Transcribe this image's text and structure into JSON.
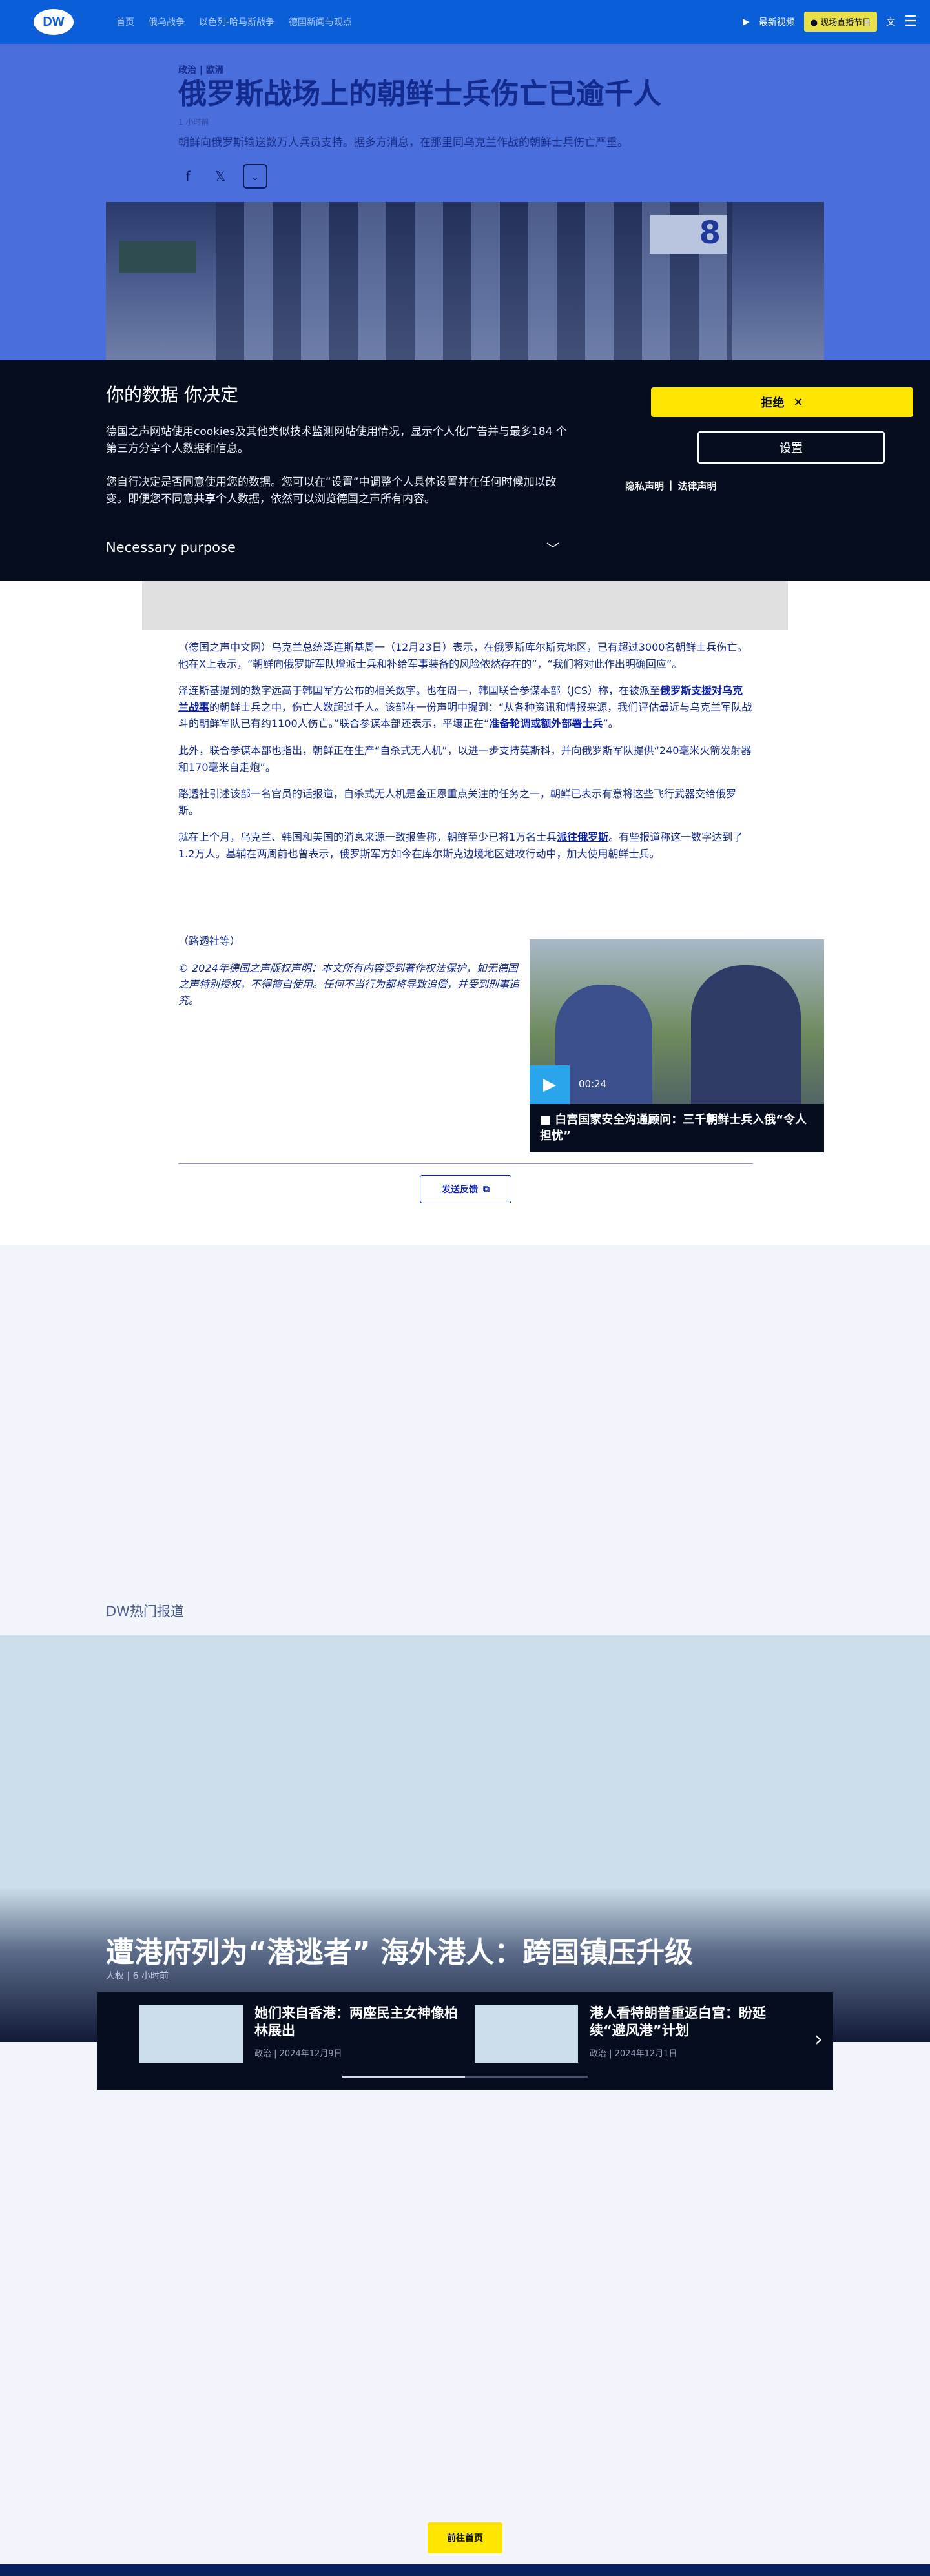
{
  "header": {
    "logo": "DW",
    "nav": [
      "首页",
      "俄乌战争",
      "以色列-哈马斯战争",
      "德国新闻与观点"
    ],
    "live_tv": "现场直播节目",
    "latest_video": "最新视频"
  },
  "article": {
    "kicker": "政治 | 欧洲",
    "title": "俄罗斯战场上的朝鲜士兵伤亡已逾千人",
    "time_ago": "1 小时前",
    "teaser": "朝鲜向俄罗斯输送数万人兵员支持。据多方消息，在那里同乌克兰作战的朝鲜士兵伤亡严重。",
    "hero_sign": "8",
    "paragraphs": [
      {
        "pre": "（德国之声中文网）乌克兰总统泽连斯基周一（12月23日）表示，在俄罗斯库尔斯克地区，已有超过3000名朝鲜士兵伤亡。他在X上表示，“朝鲜向俄罗斯军队增派士兵和补给军事装备的风险依然存在的”，“我们将对此作出明确回应”。",
        "link": "",
        "post": ""
      },
      {
        "pre": "泽连斯基提到的数字远高于韩国军方公布的相关数字。也在周一，韩国联合参谋本部（JCS）称，在被派至",
        "link": "俄罗斯支援对乌克兰战事",
        "post": "的朝鲜士兵之中，伤亡人数超过千人。该部在一份声明中提到：“从各种资讯和情报来源，我们评估最近与乌克兰军队战斗的朝鲜军队已有约1100人伤亡。”联合参谋本部还表示，平壤正在“",
        "link2": "准备轮调或额外部署士兵",
        "post2": "”。"
      },
      {
        "pre": "此外，联合参谋本部也指出，朝鲜正在生产“自杀式无人机”，以进一步支持莫斯科，并向俄罗斯军队提供“240毫米火箭发射器和170毫米自走炮”。",
        "link": "",
        "post": ""
      },
      {
        "pre": "路透社引述该部一名官员的话报道，自杀式无人机是金正恩重点关注的任务之一，朝鲜已表示有意将这些飞行武器交给俄罗斯。",
        "link": "",
        "post": ""
      },
      {
        "pre": "就在上个月，乌克兰、韩国和美国的消息来源一致报告称，朝鲜至少已将1万名士兵",
        "link": "派往俄罗斯",
        "post": "。有些报道称这一数字达到了1.2万人。基辅在两周前也曾表示，俄罗斯军方如今在库尔斯克边境地区进攻行动中，加大使用朝鲜士兵。"
      }
    ],
    "source": "（路透社等）",
    "copyright": "© 2024年德国之声版权声明：本文所有内容受到著作权法保护，如无德国之声特别授权，不得擅自使用。任何不当行为都将导致追偿，并受到刑事追究。",
    "video": {
      "duration": "00:24",
      "caption": "白宫国家安全沟通顾问：三千朝鲜士兵入俄“令人担忧”"
    },
    "feedback": "发送反馈"
  },
  "cookie": {
    "title": "你的数据 你决定",
    "p1": "德国之声网站使用cookies及其他类似技术监测网站使用情况，显示个人化广告并与最多184 个第三方分享个人数据和信息。",
    "p2": "您自行决定是否同意使用您的数据。您可以在“设置”中调整个人具体设置并在任何时候加以改变。即便您不同意共享个人数据，依然可以浏览德国之声所有内容。",
    "purpose": "Necessary purpose",
    "reject": "拒绝",
    "settings": "设置",
    "privacy": "隐私声明",
    "legal": "法律声明",
    "sep": "|"
  },
  "popular": {
    "label": "DW热门报道",
    "feature_title": "遭港府列为“潜逃者” 海外港人：跨国镇压升级",
    "feature_meta": "人权 | 6 小时前",
    "cards": [
      {
        "title": "她们来自香港：两座民主女神像柏林展出",
        "meta": "政治 | 2024年12月9日"
      },
      {
        "title": "港人看特朗普重返白宫：盼延续“避风港”计划",
        "meta": "政治 | 2024年12月1日"
      }
    ],
    "progress": 0.5
  },
  "home_button": "前往首页",
  "colors": {
    "brand": "#0a5ed8",
    "accent": "#ffe600",
    "dark": "#050d1f"
  }
}
